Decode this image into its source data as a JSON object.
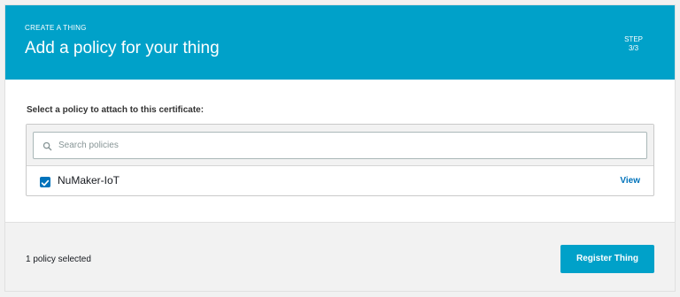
{
  "header": {
    "eyebrow": "CREATE A THING",
    "title": "Add a policy for your thing",
    "step_label": "STEP",
    "step_value": "3/3",
    "color": "#00a1c9"
  },
  "main": {
    "prompt": "Select a policy to attach to this certificate:",
    "search": {
      "placeholder": "Search policies",
      "value": "",
      "icon": "search-icon"
    },
    "policies": [
      {
        "name": "NuMaker-IoT",
        "checked": true,
        "link_label": "View"
      }
    ]
  },
  "footer": {
    "selected_count": "1 policy selected",
    "register_label": "Register Thing"
  },
  "colors": {
    "accent": "#00a1c9",
    "link": "#0073bb",
    "checkbox": "#0073bb"
  }
}
